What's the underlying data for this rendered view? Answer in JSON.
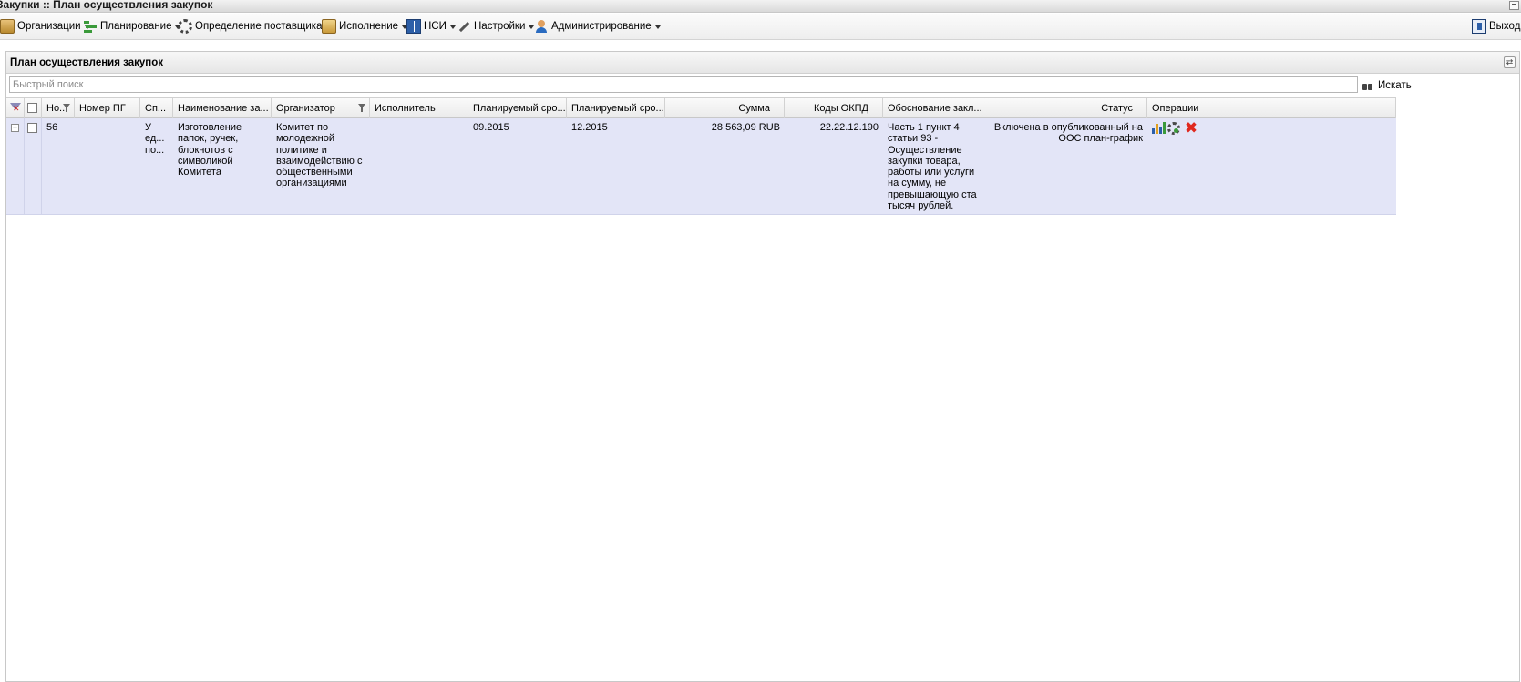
{
  "window": {
    "title": "Закупки :: План осуществления закупок"
  },
  "menu": {
    "items": [
      {
        "label": "Организации",
        "icon": "organizations-icon"
      },
      {
        "label": "Планирование",
        "icon": "planning-icon"
      },
      {
        "label": "Определение поставщика",
        "icon": "gear-icon"
      },
      {
        "label": "Исполнение",
        "icon": "execution-icon"
      },
      {
        "label": "НСИ",
        "icon": "book-icon"
      },
      {
        "label": "Настройки",
        "icon": "wrench-icon"
      },
      {
        "label": "Администрирование",
        "icon": "user-icon"
      }
    ],
    "exit_label": "Выход"
  },
  "panel": {
    "title": "План осуществления закупок",
    "refresh_icon": "refresh-icon"
  },
  "search": {
    "placeholder": "Быстрый поиск",
    "value": "",
    "button_label": "Искать"
  },
  "grid": {
    "columns": [
      "Но...",
      "Номер ПГ",
      "Сп...",
      "Наименование за...",
      "Организатор",
      "Исполнитель",
      "Планируемый сро...",
      "Планируемый сро...",
      "Сумма",
      "Коды ОКПД",
      "Обоснование закл...",
      "Статус",
      "Операции"
    ],
    "rows": [
      {
        "number": "56",
        "pg_number": "",
        "method": "У ед... по...",
        "name": "Изготовление папок, ручек, блокнотов с символикой Комитета",
        "organizer": "Комитет по молодежной политике и взаимодействию с общественными организациями",
        "executor": "",
        "planned_start": "09.2015",
        "planned_end": "12.2015",
        "sum": "28 563,09 RUB",
        "okpd": "22.22.12.190",
        "justification": "Часть 1 пункт 4 статьи 93 - Осуществление закупки товара, работы или услуги на сумму, не превышающую ста тысяч рублей.",
        "status": "Включена в опубликованный на ООС план-график",
        "operations": [
          "chart-icon",
          "settings-icon",
          "delete-icon"
        ]
      }
    ]
  },
  "colors": {
    "row_background": "#e3e5f7",
    "delete_icon": "#e0281e"
  }
}
